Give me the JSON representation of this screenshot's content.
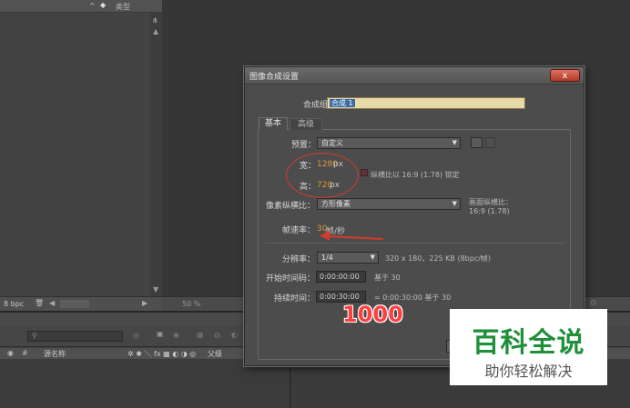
{
  "project": {
    "header_label": "类型",
    "footer_bpc": "8 bpc"
  },
  "viewer": {
    "zoom": "50 %"
  },
  "timeline": {
    "search_placeholder": "",
    "col_source": "源名称",
    "col_parent": "父级"
  },
  "dialog": {
    "title": "图像合成设置",
    "close": "x",
    "name_label": "合成组名称：",
    "name_value": "合成 1",
    "tabs": [
      "基本",
      "高级"
    ],
    "preset_label": "预置：",
    "preset_value": "自定义",
    "width_label": "宽：",
    "width_value": "1280",
    "width_unit": "px",
    "height_label": "高：",
    "height_value": "720",
    "height_unit": "px",
    "lock_ratio_label": "纵横比以 16:9 (1.78) 锁定",
    "pixel_aspect_label": "像素纵横比：",
    "pixel_aspect_value": "方形像素",
    "frame_aspect_label": "画面纵横比：",
    "frame_aspect_value": "16:9 (1.78)",
    "fps_label": "帧速率：",
    "fps_value": "30",
    "fps_unit": "帧/秒",
    "resolution_label": "分辨率：",
    "resolution_value": "1/4",
    "resolution_info": "320 x 180，225 KB (8bpc/帧)",
    "start_label": "开始时间码：",
    "start_value": "0:00:00:00",
    "start_note": "基于 30",
    "duration_label": "持续时间：",
    "duration_value": "0:00:30:00",
    "duration_note": "= 0:00:30:00  基于 30"
  },
  "annotation": {
    "big_number": "1000"
  },
  "watermark": {
    "main": "百科全说",
    "sub": "助你轻松解决"
  },
  "colors": {
    "accent_orange": "#d89a3a",
    "annotation_red": "#d43a2a",
    "watermark_green": "#1f8f3a"
  }
}
